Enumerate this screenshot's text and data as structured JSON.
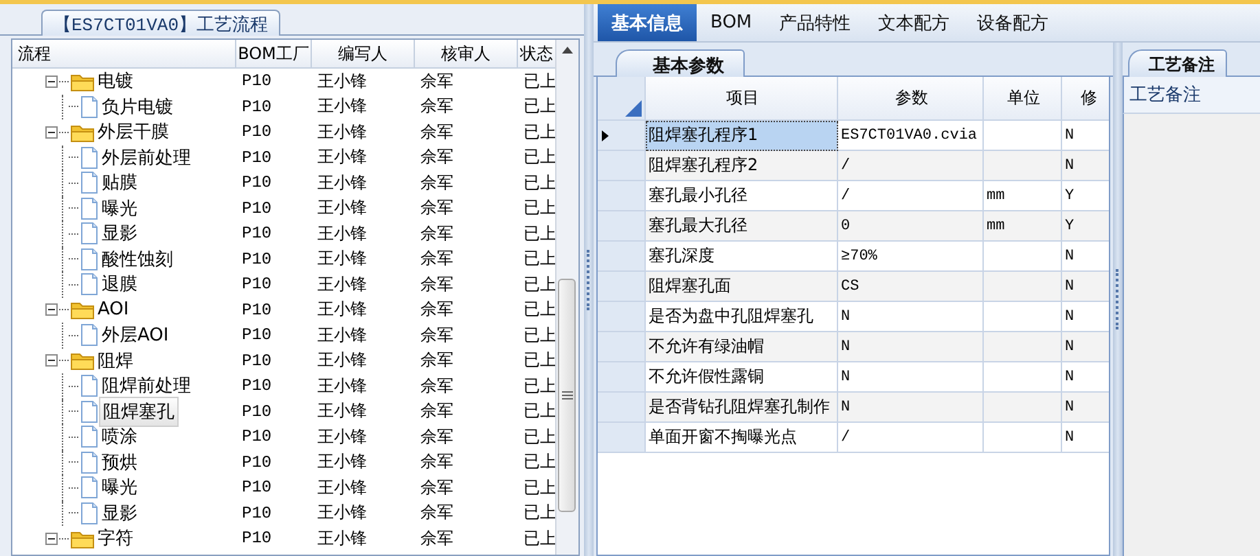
{
  "flow_panel": {
    "title": "【ES7CT01VA0】工艺流程",
    "columns": [
      "流程",
      "BOM工厂",
      "编写人",
      "核审人",
      "状态"
    ],
    "tree": [
      {
        "kind": "folder",
        "name": "电镀",
        "expanded": true,
        "selected": false,
        "bom": "P10",
        "writer": "王小锋",
        "reviewer": "佘军",
        "status": "已上",
        "children": [
          {
            "kind": "step",
            "name": "负片电镀",
            "selected": false,
            "bom": "P10",
            "writer": "王小锋",
            "reviewer": "佘军",
            "status": "已上"
          }
        ]
      },
      {
        "kind": "folder",
        "name": "外层干膜",
        "expanded": true,
        "selected": false,
        "bom": "P10",
        "writer": "王小锋",
        "reviewer": "佘军",
        "status": "已上",
        "children": [
          {
            "kind": "step",
            "name": "外层前处理",
            "selected": false,
            "bom": "P10",
            "writer": "王小锋",
            "reviewer": "佘军",
            "status": "已上"
          },
          {
            "kind": "step",
            "name": "贴膜",
            "selected": false,
            "bom": "P10",
            "writer": "王小锋",
            "reviewer": "佘军",
            "status": "已上"
          },
          {
            "kind": "step",
            "name": "曝光",
            "selected": false,
            "bom": "P10",
            "writer": "王小锋",
            "reviewer": "佘军",
            "status": "已上"
          },
          {
            "kind": "step",
            "name": "显影",
            "selected": false,
            "bom": "P10",
            "writer": "王小锋",
            "reviewer": "佘军",
            "status": "已上"
          },
          {
            "kind": "step",
            "name": "酸性蚀刻",
            "selected": false,
            "bom": "P10",
            "writer": "王小锋",
            "reviewer": "佘军",
            "status": "已上"
          },
          {
            "kind": "step",
            "name": "退膜",
            "selected": false,
            "bom": "P10",
            "writer": "王小锋",
            "reviewer": "佘军",
            "status": "已上"
          }
        ]
      },
      {
        "kind": "folder",
        "name": "AOI",
        "expanded": true,
        "selected": false,
        "bom": "P10",
        "writer": "王小锋",
        "reviewer": "佘军",
        "status": "已上",
        "children": [
          {
            "kind": "step",
            "name": "外层AOI",
            "selected": false,
            "bom": "P10",
            "writer": "王小锋",
            "reviewer": "佘军",
            "status": "已上"
          }
        ]
      },
      {
        "kind": "folder",
        "name": "阻焊",
        "expanded": true,
        "selected": false,
        "bom": "P10",
        "writer": "王小锋",
        "reviewer": "佘军",
        "status": "已上",
        "children": [
          {
            "kind": "step",
            "name": "阻焊前处理",
            "selected": false,
            "bom": "P10",
            "writer": "王小锋",
            "reviewer": "佘军",
            "status": "已上"
          },
          {
            "kind": "step",
            "name": "阻焊塞孔",
            "selected": true,
            "bom": "P10",
            "writer": "王小锋",
            "reviewer": "佘军",
            "status": "已上"
          },
          {
            "kind": "step",
            "name": "喷涂",
            "selected": false,
            "bom": "P10",
            "writer": "王小锋",
            "reviewer": "佘军",
            "status": "已上"
          },
          {
            "kind": "step",
            "name": "预烘",
            "selected": false,
            "bom": "P10",
            "writer": "王小锋",
            "reviewer": "佘军",
            "status": "已上"
          },
          {
            "kind": "step",
            "name": "曝光",
            "selected": false,
            "bom": "P10",
            "writer": "王小锋",
            "reviewer": "佘军",
            "status": "已上"
          },
          {
            "kind": "step",
            "name": "显影",
            "selected": false,
            "bom": "P10",
            "writer": "王小锋",
            "reviewer": "佘军",
            "status": "已上"
          }
        ]
      },
      {
        "kind": "folder",
        "name": "字符",
        "expanded": true,
        "selected": false,
        "bom": "P10",
        "writer": "王小锋",
        "reviewer": "佘军",
        "status": "已上"
      }
    ]
  },
  "tabs": [
    {
      "label": "基本信息",
      "selected": true
    },
    {
      "label": "BOM",
      "selected": false
    },
    {
      "label": "产品特性",
      "selected": false
    },
    {
      "label": "文本配方",
      "selected": false
    },
    {
      "label": "设备配方",
      "selected": false
    }
  ],
  "params_panel": {
    "tab": "基本参数",
    "columns": [
      "项目",
      "参数",
      "单位",
      "修"
    ],
    "rows": [
      {
        "item": "阻焊塞孔程序1",
        "value": "ES7CT01VA0.cvia",
        "unit": "",
        "modified": "N",
        "selected": true
      },
      {
        "item": "阻焊塞孔程序2",
        "value": "/",
        "unit": "",
        "modified": "N",
        "selected": false
      },
      {
        "item": "塞孔最小孔径",
        "value": "/",
        "unit": "mm",
        "modified": "Y",
        "selected": false
      },
      {
        "item": "塞孔最大孔径",
        "value": "0",
        "unit": "mm",
        "modified": "Y",
        "selected": false
      },
      {
        "item": "塞孔深度",
        "value": "≥70%",
        "unit": "",
        "modified": "N",
        "selected": false
      },
      {
        "item": "阻焊塞孔面",
        "value": "CS",
        "unit": "",
        "modified": "N",
        "selected": false
      },
      {
        "item": "是否为盘中孔阻焊塞孔",
        "value": "N",
        "unit": "",
        "modified": "N",
        "selected": false
      },
      {
        "item": "不允许有绿油帽",
        "value": "N",
        "unit": "",
        "modified": "N",
        "selected": false
      },
      {
        "item": "不允许假性露铜",
        "value": "N",
        "unit": "",
        "modified": "N",
        "selected": false
      },
      {
        "item": "是否背钻孔阻焊塞孔制作",
        "value": "N",
        "unit": "",
        "modified": "N",
        "selected": false
      },
      {
        "item": "单面开窗不掏曝光点",
        "value": "/",
        "unit": "",
        "modified": "N",
        "selected": false
      }
    ]
  },
  "notes_panel": {
    "tab": "工艺备注",
    "label": "工艺备注"
  }
}
